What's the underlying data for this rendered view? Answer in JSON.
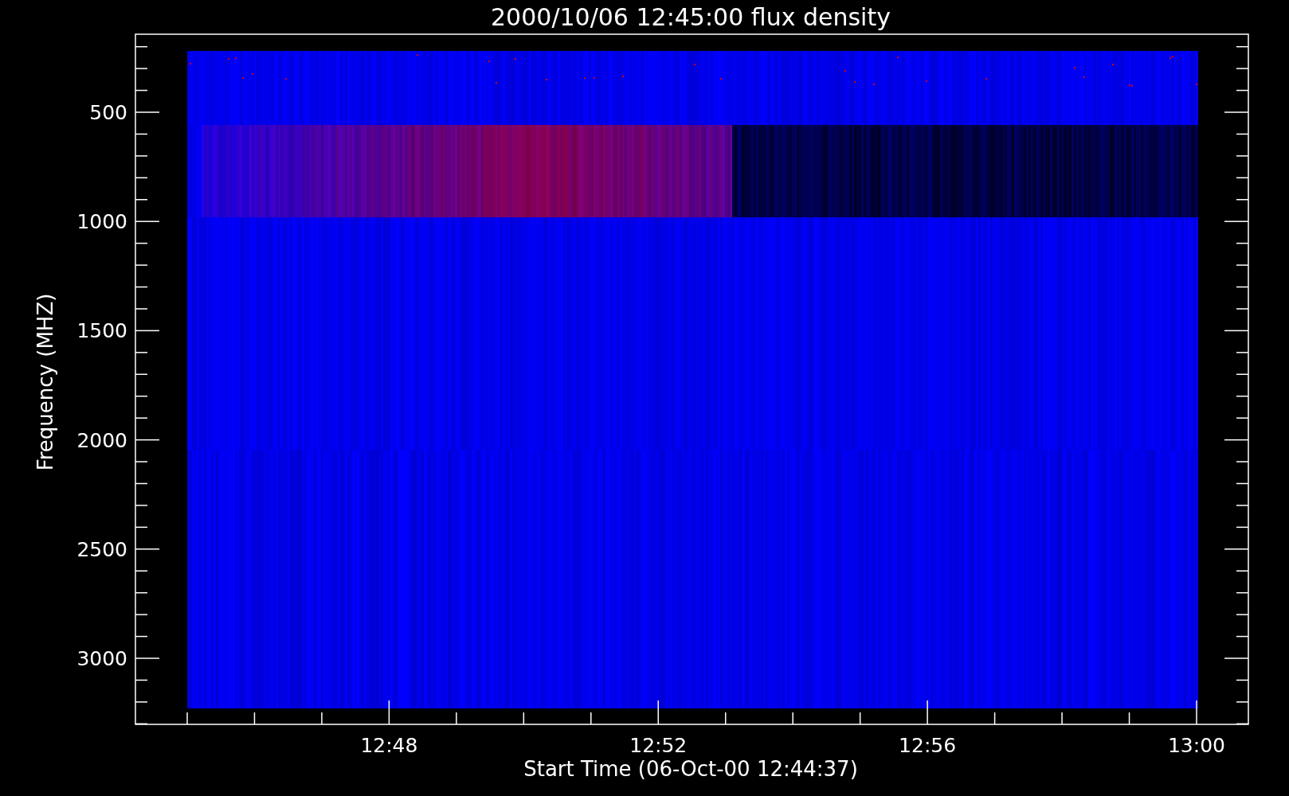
{
  "title": "2000/10/06 12:45:00 flux density",
  "ylabel": "Frequency (MHZ)",
  "xlabel": "Start Time (06-Oct-00 12:44:37)",
  "yticks": [
    "500",
    "1000",
    "1500",
    "2000",
    "2500",
    "3000"
  ],
  "xticks": [
    "12:48",
    "12:52",
    "12:56",
    "13:00"
  ]
}
